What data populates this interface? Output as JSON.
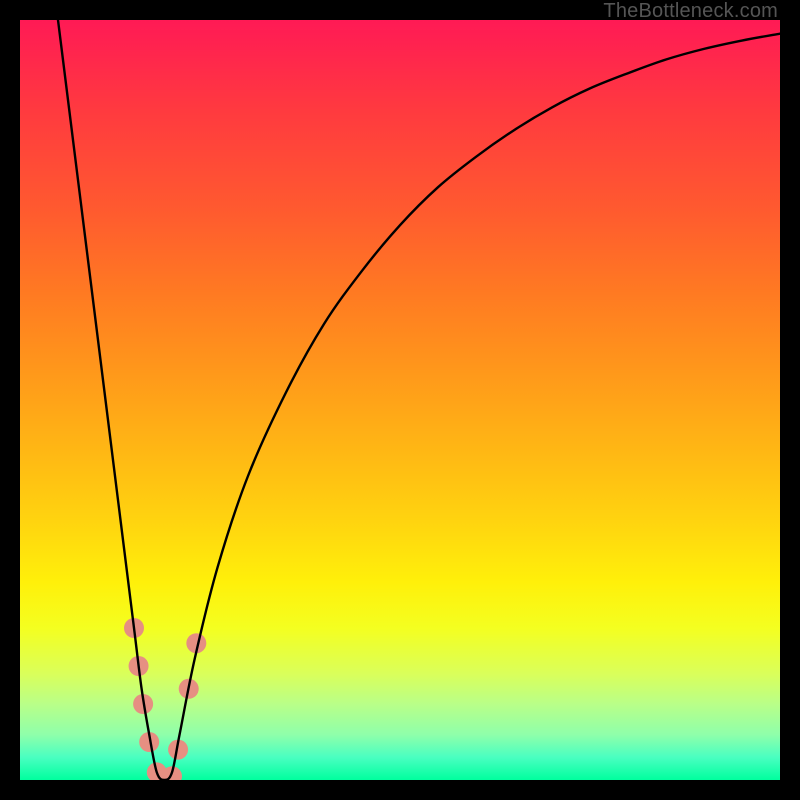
{
  "watermark": "TheBottleneck.com",
  "chart_data": {
    "type": "line",
    "title": "",
    "xlabel": "",
    "ylabel": "",
    "xlim": [
      0,
      100
    ],
    "ylim": [
      0,
      100
    ],
    "series": [
      {
        "name": "bottleneck-curve",
        "x": [
          5,
          7,
          9,
          11,
          13,
          15,
          16,
          17,
          18,
          19,
          20,
          21,
          23,
          26,
          30,
          35,
          40,
          45,
          50,
          55,
          60,
          65,
          70,
          75,
          80,
          85,
          90,
          95,
          100
        ],
        "values": [
          100,
          84,
          68,
          52,
          36,
          20,
          12,
          6,
          1,
          0,
          1,
          6,
          16,
          28,
          40,
          51,
          60,
          67,
          73,
          78,
          82,
          85.5,
          88.5,
          91,
          93,
          94.8,
          96.2,
          97.3,
          98.2
        ]
      }
    ],
    "markers": {
      "name": "highlight-dots",
      "color": "#e68f82",
      "radius_px": 10,
      "points": [
        {
          "x": 15.0,
          "y": 20.0
        },
        {
          "x": 15.6,
          "y": 15.0
        },
        {
          "x": 16.2,
          "y": 10.0
        },
        {
          "x": 17.0,
          "y": 5.0
        },
        {
          "x": 18.0,
          "y": 1.0
        },
        {
          "x": 19.0,
          "y": 0.0
        },
        {
          "x": 20.0,
          "y": 0.5
        },
        {
          "x": 20.8,
          "y": 4.0
        },
        {
          "x": 22.2,
          "y": 12.0
        },
        {
          "x": 23.2,
          "y": 18.0
        }
      ]
    },
    "gradient_stops": [
      {
        "pos": 0.0,
        "color": "#ff1a55"
      },
      {
        "pos": 0.25,
        "color": "#ff5a2f"
      },
      {
        "pos": 0.5,
        "color": "#ffaa15"
      },
      {
        "pos": 0.75,
        "color": "#fff00a"
      },
      {
        "pos": 0.9,
        "color": "#b9ff88"
      },
      {
        "pos": 1.0,
        "color": "#00ff9e"
      }
    ]
  }
}
